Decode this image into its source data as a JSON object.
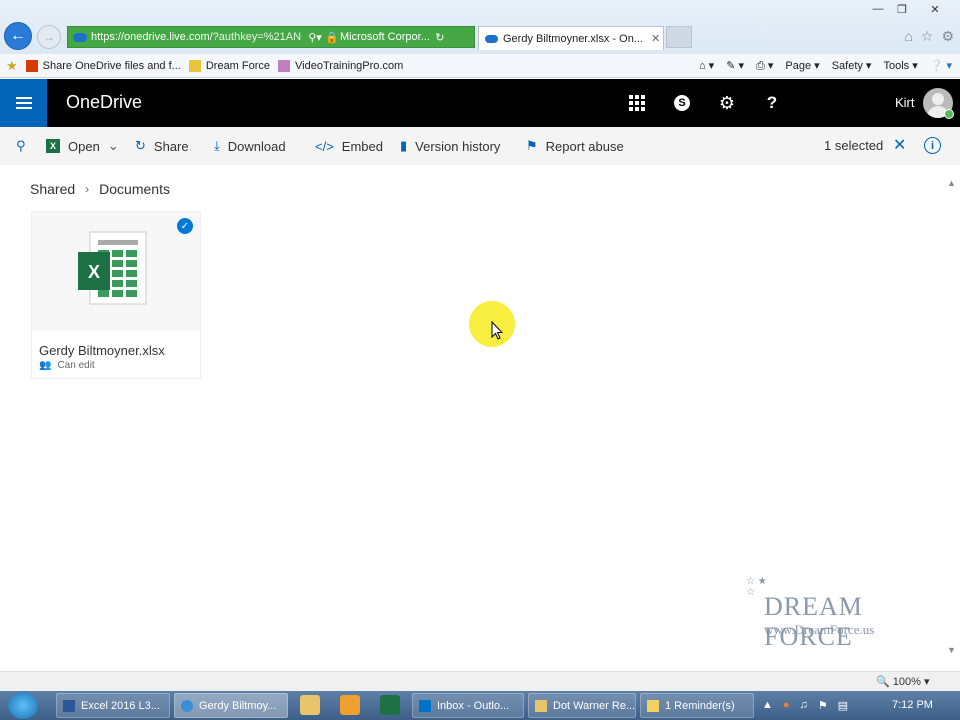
{
  "browser": {
    "url_host": "https://onedrive.live.com",
    "url_rest": "/?authkey=%21AN",
    "site_identity": "Microsoft Corpor...",
    "active_tab": "Gerdy Biltmoyner.xlsx - On...",
    "favorites": [
      "Share OneDrive files and f...",
      "Dream Force",
      "VideoTrainingPro.com"
    ],
    "tools": [
      "Page",
      "Safety",
      "Tools"
    ]
  },
  "header": {
    "app_title": "OneDrive",
    "user_name": "Kirt"
  },
  "command_bar": {
    "open": "Open",
    "share": "Share",
    "download": "Download",
    "embed": "Embed",
    "version_history": "Version history",
    "report_abuse": "Report abuse",
    "selected_count": "1 selected"
  },
  "breadcrumb": [
    "Shared",
    "Documents"
  ],
  "files": [
    {
      "name": "Gerdy Biltmoyner.xlsx",
      "permission": "Can edit",
      "selected": true
    }
  ],
  "watermark": {
    "brand": "DREAM FORCE",
    "url": "www.DreamForce.us"
  },
  "status": {
    "zoom": "100%"
  },
  "taskbar": {
    "items": [
      "Excel 2016 L3...",
      "Gerdy Biltmoy...",
      "Inbox - Outlo...",
      "Dot Warner Re...",
      "1 Reminder(s)"
    ],
    "clock": "7:12 PM"
  },
  "colors": {
    "accent": "#0364b8",
    "excel": "#1e7145",
    "header": "#000000"
  }
}
